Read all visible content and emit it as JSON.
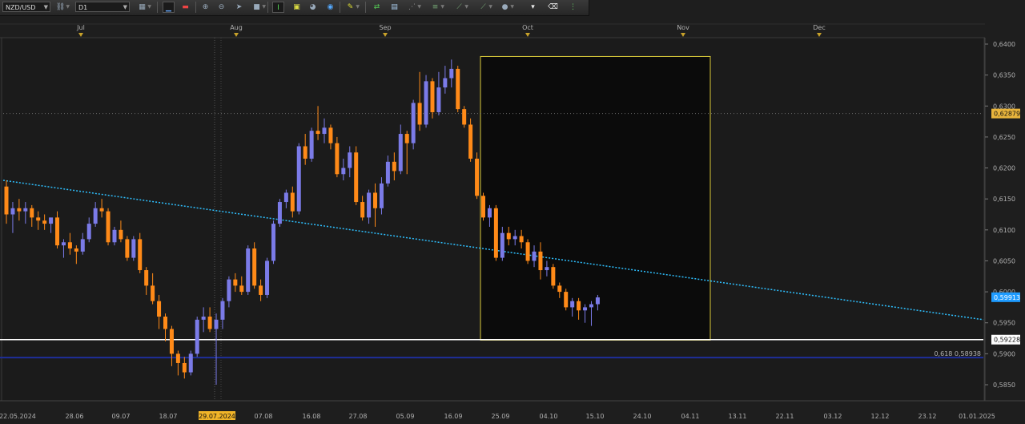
{
  "toolbar": {
    "symbol": "NZD/USD",
    "timeframe": "D1",
    "tools": [
      "chain-icon",
      "chart-type-icon",
      "line-study-icon",
      "indicator-icon",
      "zoom-in-icon",
      "zoom-out-icon",
      "cursor-icon",
      "dot-icon",
      "crosshair-icon",
      "template-icon",
      "palette-icon",
      "globe-icon",
      "pencil-icon",
      "trade-icon",
      "window-icon",
      "grid-icon",
      "fib-icon",
      "channel-icon",
      "trendline-icon",
      "pen-icon",
      "circle-icon",
      "eraser-icon",
      "settings-dots-icon"
    ]
  },
  "months": [
    {
      "label": "Jul",
      "date": "2024-07-01"
    },
    {
      "label": "Aug",
      "date": "2024-08-01"
    },
    {
      "label": "Sep",
      "date": "2024-09-01"
    },
    {
      "label": "Oct",
      "date": "2024-10-01"
    },
    {
      "label": "Nov",
      "date": "2024-11-01"
    },
    {
      "label": "Dec",
      "date": "2024-12-01"
    }
  ],
  "date_ticks": [
    "22.05.2024",
    "28.06",
    "09.07",
    "18.07",
    "29.07.2024",
    "07.08",
    "16.08",
    "27.08",
    "05.09",
    "16.09",
    "25.09",
    "04.10",
    "15.10",
    "24.10",
    "04.11",
    "13.11",
    "22.11",
    "03.12",
    "12.12",
    "23.12",
    "01.01.2025"
  ],
  "highlighted_date": "29.07.2024",
  "price_ticks": [
    "0,6400",
    "0,6350",
    "0,6300",
    "0,6250",
    "0,6200",
    "0,6150",
    "0,6100",
    "0,6050",
    "0,6000",
    "0,5950",
    "0,5900",
    "0,5850"
  ],
  "price_tags": {
    "dotted_level": "0,62879",
    "current_price": "0,59913",
    "support_level": "0,59228"
  },
  "fib_label": "0,618 0,58938",
  "colors": {
    "bull": "#7b7be8",
    "bear": "#ff8a18",
    "trendline": "#2ec0ff",
    "box_border": "#d8c93a",
    "support": "#ffffff",
    "fib": "#1e2e9a",
    "current_tag": "#1e9bff",
    "dotted_tag": "#e8b43c"
  },
  "chart_data": {
    "type": "candlestick",
    "symbol": "NZD/USD",
    "timeframe": "D1",
    "ylim": [
      0.5825,
      0.642
    ],
    "candles": [
      [
        0.617,
        0.618,
        0.611,
        0.6125
      ],
      [
        0.6125,
        0.6145,
        0.6095,
        0.6135
      ],
      [
        0.6135,
        0.615,
        0.6115,
        0.613
      ],
      [
        0.613,
        0.6145,
        0.611,
        0.6135
      ],
      [
        0.6135,
        0.614,
        0.6105,
        0.612
      ],
      [
        0.612,
        0.613,
        0.61,
        0.6115
      ],
      [
        0.6115,
        0.6125,
        0.61,
        0.611
      ],
      [
        0.611,
        0.612,
        0.6095,
        0.612
      ],
      [
        0.612,
        0.613,
        0.607,
        0.6075
      ],
      [
        0.6075,
        0.6085,
        0.6055,
        0.608
      ],
      [
        0.608,
        0.6095,
        0.606,
        0.607
      ],
      [
        0.607,
        0.6075,
        0.6045,
        0.6065
      ],
      [
        0.6065,
        0.6095,
        0.606,
        0.6085
      ],
      [
        0.6085,
        0.612,
        0.608,
        0.611
      ],
      [
        0.611,
        0.6145,
        0.6105,
        0.6135
      ],
      [
        0.6135,
        0.615,
        0.612,
        0.613
      ],
      [
        0.613,
        0.6135,
        0.6075,
        0.608
      ],
      [
        0.608,
        0.6105,
        0.6075,
        0.61
      ],
      [
        0.61,
        0.6115,
        0.608,
        0.6085
      ],
      [
        0.6085,
        0.609,
        0.605,
        0.6055
      ],
      [
        0.6055,
        0.609,
        0.605,
        0.6085
      ],
      [
        0.6085,
        0.6095,
        0.603,
        0.6035
      ],
      [
        0.6035,
        0.604,
        0.5995,
        0.601
      ],
      [
        0.601,
        0.603,
        0.598,
        0.5985
      ],
      [
        0.5985,
        0.5995,
        0.594,
        0.596
      ],
      [
        0.596,
        0.5965,
        0.592,
        0.594
      ],
      [
        0.594,
        0.5945,
        0.588,
        0.59
      ],
      [
        0.59,
        0.5905,
        0.5865,
        0.5885
      ],
      [
        0.5885,
        0.5895,
        0.586,
        0.587
      ],
      [
        0.587,
        0.5905,
        0.5865,
        0.59
      ],
      [
        0.59,
        0.596,
        0.5895,
        0.5955
      ],
      [
        0.5955,
        0.5975,
        0.5935,
        0.596
      ],
      [
        0.596,
        0.5975,
        0.5935,
        0.594
      ],
      [
        0.594,
        0.5965,
        0.585,
        0.5955
      ],
      [
        0.5955,
        0.599,
        0.594,
        0.5985
      ],
      [
        0.5985,
        0.6025,
        0.5975,
        0.602
      ],
      [
        0.602,
        0.603,
        0.6,
        0.601
      ],
      [
        0.601,
        0.6025,
        0.5995,
        0.6
      ],
      [
        0.6,
        0.6075,
        0.5995,
        0.607
      ],
      [
        0.607,
        0.608,
        0.6005,
        0.601
      ],
      [
        0.601,
        0.602,
        0.5985,
        0.5995
      ],
      [
        0.5995,
        0.6055,
        0.599,
        0.605
      ],
      [
        0.605,
        0.6115,
        0.6045,
        0.611
      ],
      [
        0.611,
        0.615,
        0.6105,
        0.6145
      ],
      [
        0.6145,
        0.6165,
        0.6135,
        0.616
      ],
      [
        0.616,
        0.617,
        0.612,
        0.613
      ],
      [
        0.613,
        0.624,
        0.6125,
        0.6235
      ],
      [
        0.6235,
        0.6255,
        0.6205,
        0.6215
      ],
      [
        0.6215,
        0.6265,
        0.621,
        0.626
      ],
      [
        0.626,
        0.63,
        0.6245,
        0.6255
      ],
      [
        0.6255,
        0.628,
        0.624,
        0.6265
      ],
      [
        0.6265,
        0.627,
        0.623,
        0.624
      ],
      [
        0.624,
        0.625,
        0.6185,
        0.619
      ],
      [
        0.619,
        0.6215,
        0.618,
        0.62
      ],
      [
        0.62,
        0.6235,
        0.6185,
        0.6225
      ],
      [
        0.6225,
        0.6235,
        0.614,
        0.6145
      ],
      [
        0.6145,
        0.6155,
        0.6115,
        0.612
      ],
      [
        0.612,
        0.6165,
        0.611,
        0.616
      ],
      [
        0.616,
        0.6175,
        0.6105,
        0.6135
      ],
      [
        0.6135,
        0.6185,
        0.6125,
        0.6175
      ],
      [
        0.6175,
        0.622,
        0.617,
        0.621
      ],
      [
        0.621,
        0.6225,
        0.618,
        0.6195
      ],
      [
        0.6195,
        0.627,
        0.619,
        0.6255
      ],
      [
        0.6255,
        0.626,
        0.619,
        0.624
      ],
      [
        0.624,
        0.631,
        0.623,
        0.6305
      ],
      [
        0.6305,
        0.6355,
        0.626,
        0.627
      ],
      [
        0.627,
        0.635,
        0.6265,
        0.634
      ],
      [
        0.634,
        0.6345,
        0.628,
        0.629
      ],
      [
        0.629,
        0.6355,
        0.6285,
        0.633
      ],
      [
        0.633,
        0.6365,
        0.632,
        0.6345
      ],
      [
        0.6345,
        0.6375,
        0.633,
        0.636
      ],
      [
        0.636,
        0.6365,
        0.629,
        0.6295
      ],
      [
        0.6295,
        0.63,
        0.6265,
        0.627
      ],
      [
        0.627,
        0.628,
        0.621,
        0.6215
      ],
      [
        0.6215,
        0.6225,
        0.615,
        0.6155
      ],
      [
        0.6155,
        0.616,
        0.6115,
        0.612
      ],
      [
        0.612,
        0.614,
        0.6105,
        0.6135
      ],
      [
        0.6135,
        0.614,
        0.605,
        0.6055
      ],
      [
        0.6055,
        0.6105,
        0.605,
        0.6095
      ],
      [
        0.6095,
        0.6105,
        0.6075,
        0.6085
      ],
      [
        0.6085,
        0.61,
        0.6075,
        0.609
      ],
      [
        0.609,
        0.61,
        0.607,
        0.608
      ],
      [
        0.608,
        0.6085,
        0.6045,
        0.605
      ],
      [
        0.605,
        0.6075,
        0.604,
        0.6065
      ],
      [
        0.6065,
        0.608,
        0.602,
        0.6035
      ],
      [
        0.6035,
        0.605,
        0.6025,
        0.604
      ],
      [
        0.604,
        0.6045,
        0.6005,
        0.601
      ],
      [
        0.601,
        0.6015,
        0.599,
        0.6
      ],
      [
        0.6,
        0.6005,
        0.597,
        0.5975
      ],
      [
        0.5975,
        0.599,
        0.596,
        0.5985
      ],
      [
        0.5985,
        0.599,
        0.5955,
        0.597
      ],
      [
        0.597,
        0.598,
        0.595,
        0.5975
      ],
      [
        0.5975,
        0.5985,
        0.5945,
        0.598
      ],
      [
        0.598,
        0.5995,
        0.597,
        0.5991
      ]
    ],
    "lines": [
      {
        "kind": "trendline",
        "from": [
          0.0,
          0.618
        ],
        "to": [
          1.0,
          0.5955
        ]
      },
      {
        "kind": "horizontal",
        "price": 0.62879,
        "style": "dotted"
      },
      {
        "kind": "horizontal",
        "price": 0.59228,
        "style": "solid"
      },
      {
        "kind": "horizontal",
        "price": 0.58938,
        "style": "fib",
        "label": "0,618 0,58938"
      }
    ],
    "highlight_box": {
      "from_candle": 64,
      "to_candle": 94,
      "price_top": 0.638,
      "price_bottom": 0.5922
    }
  }
}
